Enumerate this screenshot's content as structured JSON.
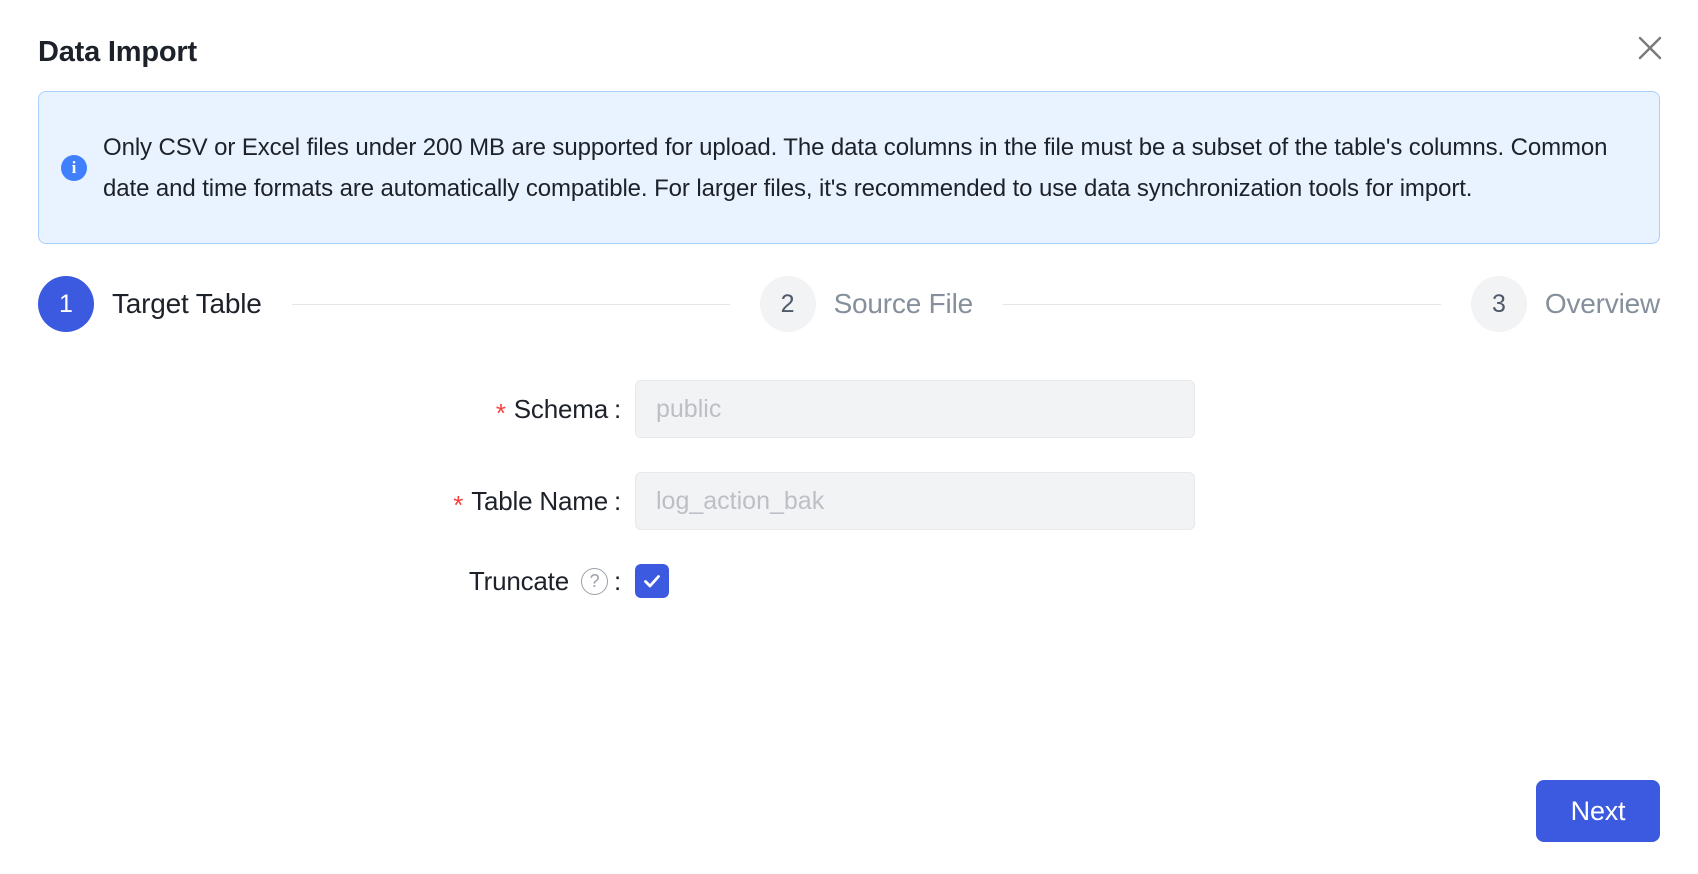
{
  "dialog": {
    "title": "Data Import",
    "close_icon": "close-icon"
  },
  "banner": {
    "icon": "info-icon",
    "text": "Only CSV or Excel files under 200 MB are supported for upload. The data columns in the file must be a subset of the table's columns. Common date and time formats are automatically compatible. For larger files, it's recommended to use data synchronization tools for import.",
    "background_color": "#e8f3ff",
    "border_color": "#a8d0fb",
    "icon_color": "#4080ff"
  },
  "stepper": {
    "active_color": "#3c5ae0",
    "inactive_color": "#f2f3f5",
    "steps": [
      {
        "number": "1",
        "label": "Target Table",
        "state": "active"
      },
      {
        "number": "2",
        "label": "Source File",
        "state": "inactive"
      },
      {
        "number": "3",
        "label": "Overview",
        "state": "inactive"
      }
    ]
  },
  "form": {
    "schema": {
      "required_mark": "*",
      "label": "Schema",
      "colon": ":",
      "value": "",
      "placeholder": "public"
    },
    "table_name": {
      "required_mark": "*",
      "label": "Table Name",
      "colon": ":",
      "value": "",
      "placeholder": "log_action_bak"
    },
    "truncate": {
      "label": "Truncate",
      "help_icon": "?",
      "colon": ":",
      "checked": true
    }
  },
  "footer": {
    "next_label": "Next",
    "next_color": "#3c5ae0"
  }
}
